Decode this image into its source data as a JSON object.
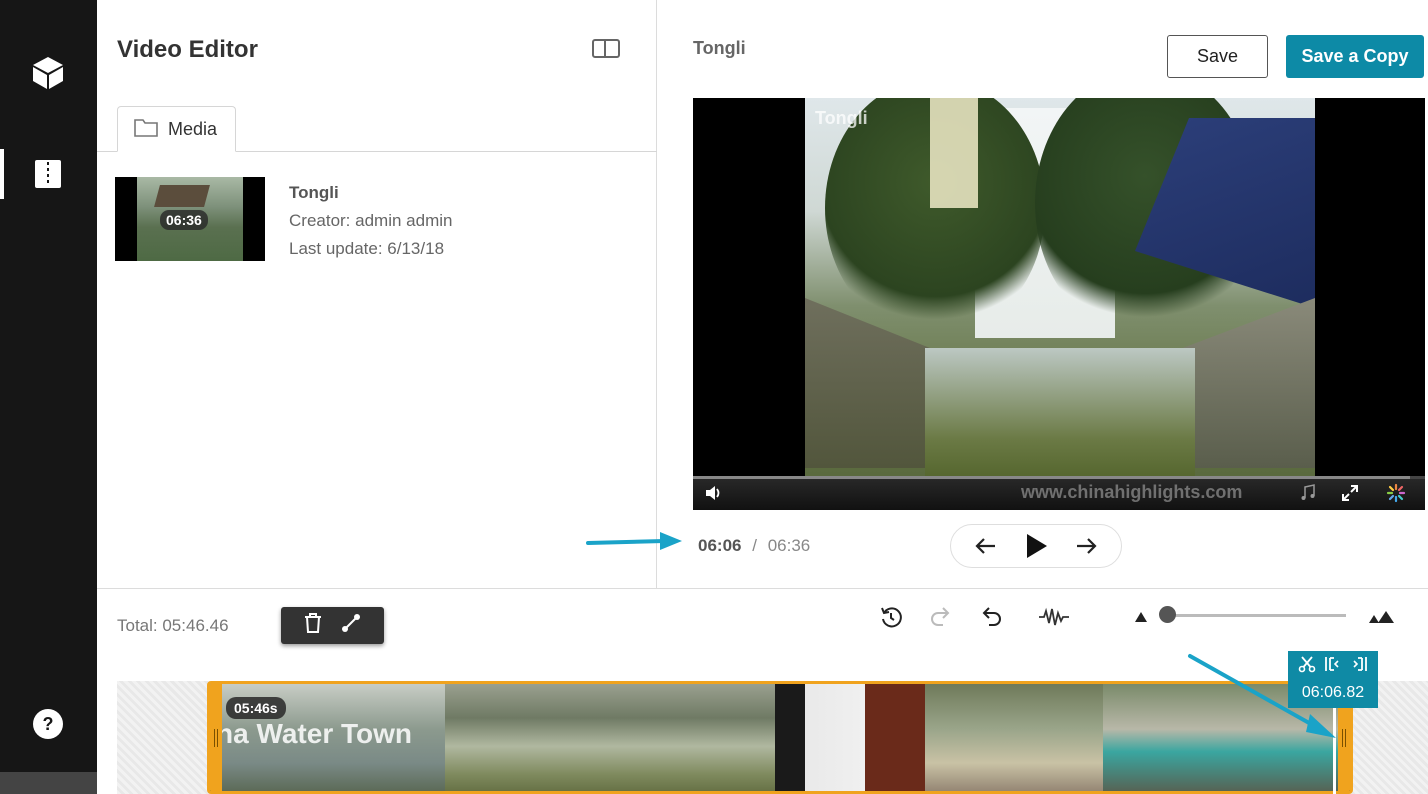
{
  "sidebar": {
    "items": [
      {
        "icon": "cube-icon"
      },
      {
        "icon": "editor-icon",
        "active": true
      },
      {
        "icon": "help-icon"
      }
    ]
  },
  "header": {
    "title": "Video Editor"
  },
  "media_tab": {
    "label": "Media"
  },
  "entry": {
    "name": "Tongli",
    "creator": "Creator: admin admin",
    "last_update": "Last update: 6/13/18",
    "duration": "06:36"
  },
  "player": {
    "title": "Tongli",
    "watermark_top": "Tongli",
    "watermark_bottom": "www.chinahighlights.com",
    "progress": 0.98
  },
  "actions": {
    "save_label": "Save",
    "save_copy_label": "Save a Copy"
  },
  "timecode": {
    "current": "06:06",
    "separator": "/",
    "total": "06:36"
  },
  "timeline": {
    "total": "Total: 05:46.46",
    "clip_title": "na Water Town",
    "clip_duration": "05:46s",
    "playhead_time": "06:06.82"
  },
  "colors": {
    "accent": "#0d8aa6",
    "clip_border": "#f0a31e",
    "rail": "#161616"
  }
}
